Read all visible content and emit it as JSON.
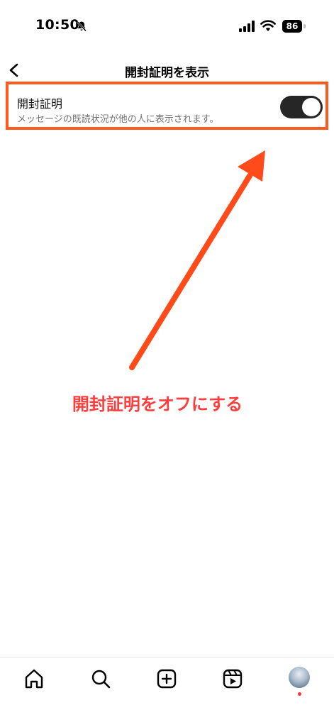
{
  "status_bar": {
    "time": "10:50",
    "battery": "86",
    "icons": [
      "bell-slash-icon",
      "signal-icon",
      "wifi-icon",
      "battery-icon"
    ]
  },
  "header": {
    "title": "開封証明を表示",
    "back_icon": "chevron-left-icon"
  },
  "setting": {
    "title": "開封証明",
    "description": "メッセージの既読状況が他の人に表示されます。",
    "toggle_state": "on"
  },
  "annotation": {
    "text": "開封証明をオフにする",
    "color": "#ff3d3d",
    "highlight_color": "#ff5b1f"
  },
  "bottom_nav": {
    "items": [
      "home-icon",
      "search-icon",
      "create-icon",
      "reels-icon",
      "profile-avatar"
    ]
  }
}
